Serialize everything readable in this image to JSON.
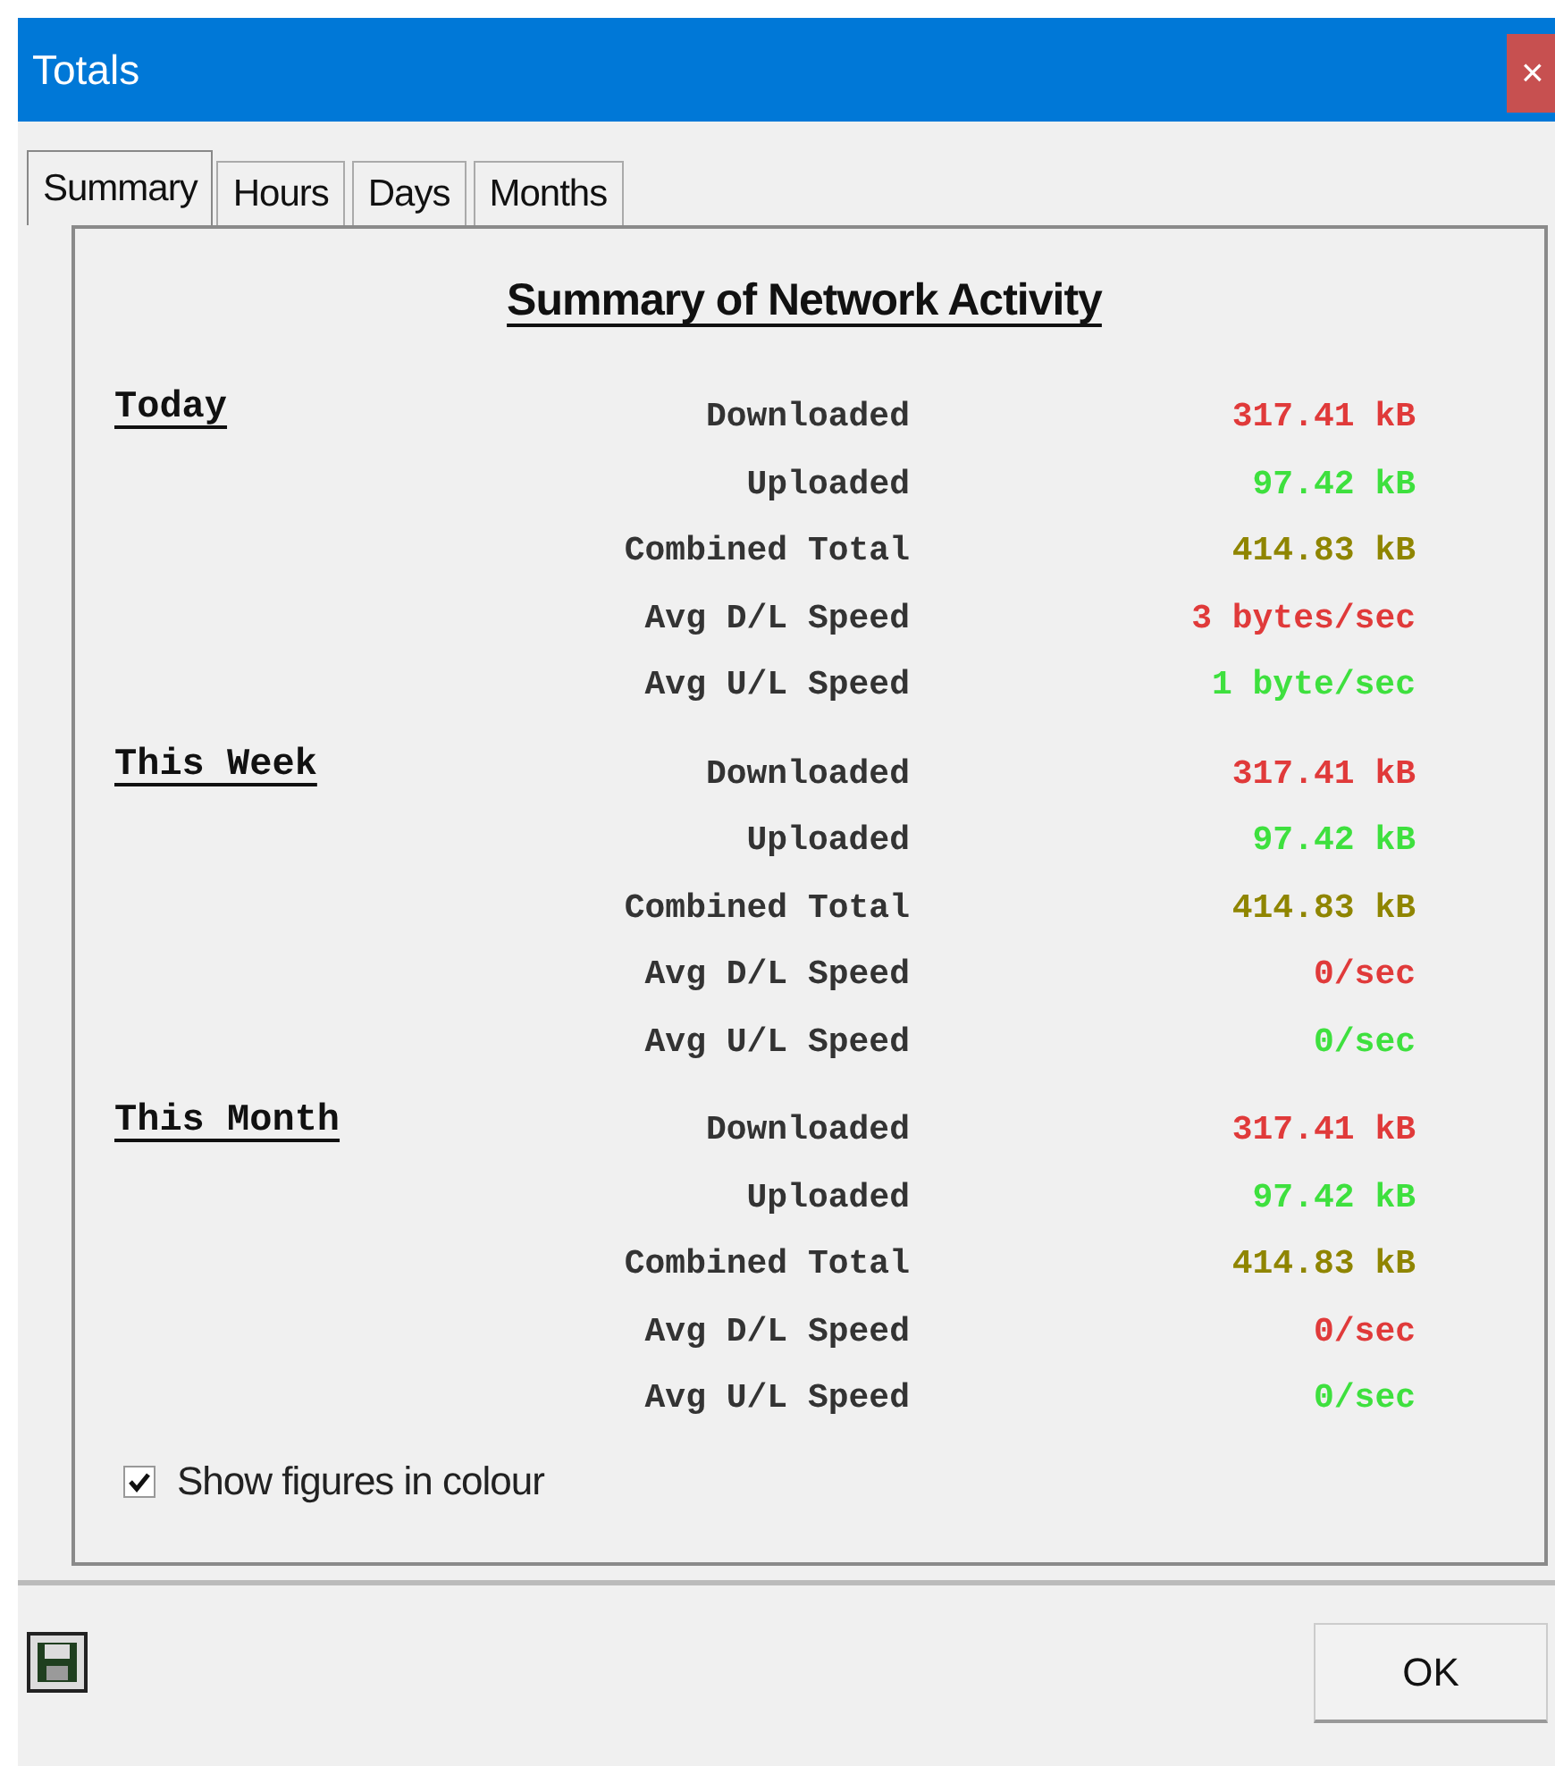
{
  "window": {
    "title": "Totals",
    "close": "×"
  },
  "tabs": [
    {
      "label": "Summary",
      "selected": true
    },
    {
      "label": "Hours",
      "selected": false
    },
    {
      "label": "Days",
      "selected": false
    },
    {
      "label": "Months",
      "selected": false
    }
  ],
  "heading": "Summary of Network Activity",
  "sections": [
    {
      "title": "Today",
      "rows": [
        {
          "label": "Downloaded",
          "value": "317.41 kB",
          "color": "#e03a3a"
        },
        {
          "label": "Uploaded",
          "value": "97.42 kB",
          "color": "#3ee03e"
        },
        {
          "label": "Combined Total",
          "value": "414.83 kB",
          "color": "#8f8500"
        },
        {
          "label": "Avg D/L Speed",
          "value": "3 bytes/sec",
          "color": "#e03a3a"
        },
        {
          "label": "Avg U/L Speed",
          "value": "1 byte/sec",
          "color": "#3ee03e"
        }
      ]
    },
    {
      "title": "This Week",
      "rows": [
        {
          "label": "Downloaded",
          "value": "317.41 kB",
          "color": "#e03a3a"
        },
        {
          "label": "Uploaded",
          "value": "97.42 kB",
          "color": "#3ee03e"
        },
        {
          "label": "Combined Total",
          "value": "414.83 kB",
          "color": "#8f8500"
        },
        {
          "label": "Avg D/L Speed",
          "value": "0/sec",
          "color": "#e03a3a"
        },
        {
          "label": "Avg U/L Speed",
          "value": "0/sec",
          "color": "#3ee03e"
        }
      ]
    },
    {
      "title": "This Month",
      "rows": [
        {
          "label": "Downloaded",
          "value": "317.41 kB",
          "color": "#e03a3a"
        },
        {
          "label": "Uploaded",
          "value": "97.42 kB",
          "color": "#3ee03e"
        },
        {
          "label": "Combined Total",
          "value": "414.83 kB",
          "color": "#8f8500"
        },
        {
          "label": "Avg D/L Speed",
          "value": "0/sec",
          "color": "#e03a3a"
        },
        {
          "label": "Avg U/L Speed",
          "value": "0/sec",
          "color": "#3ee03e"
        }
      ]
    }
  ],
  "colour_option": {
    "label": "Show figures in colour",
    "checked": true
  },
  "ok_button": "OK"
}
